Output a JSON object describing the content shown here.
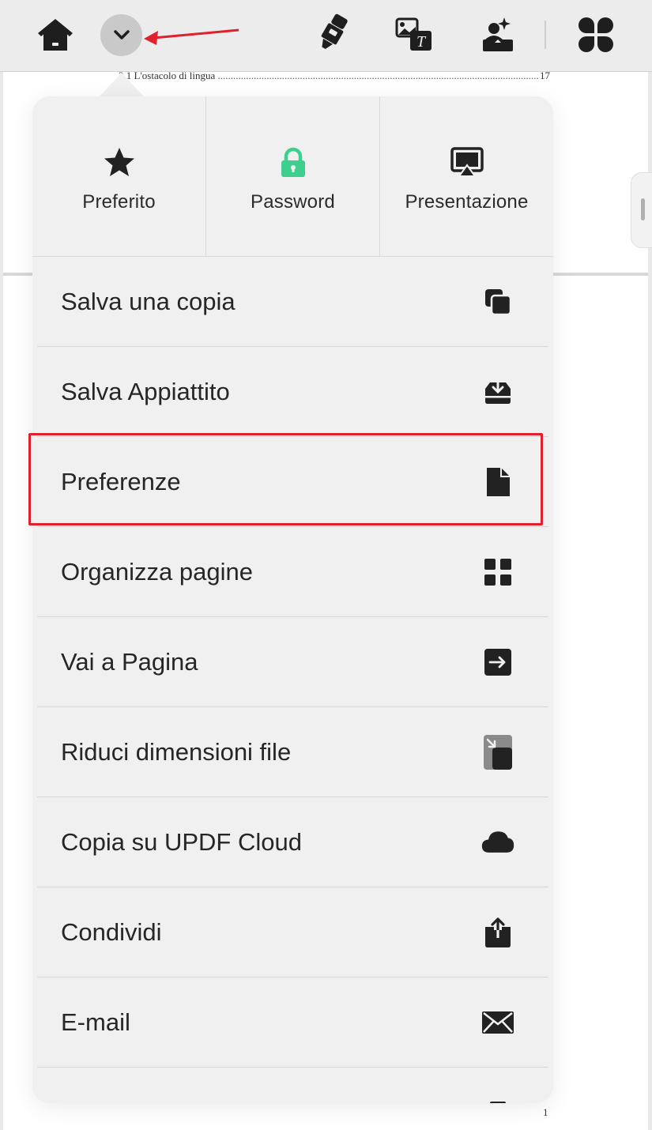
{
  "document": {
    "toc_line": "2.1 L'ostacolo di lingua",
    "toc_line_page": "17",
    "footer_page": "1"
  },
  "toolbar": {
    "icons": [
      "home-icon",
      "chevron-down-icon",
      "highlighter-icon",
      "ocr-icon",
      "ai-image-icon",
      "apps-icon"
    ]
  },
  "quick_actions": [
    {
      "label": "Preferito",
      "icon": "star-icon"
    },
    {
      "label": "Password",
      "icon": "lock-icon",
      "color": "#3ecf8e"
    },
    {
      "label": "Presentazione",
      "icon": "presentation-icon"
    }
  ],
  "menu": {
    "items": [
      {
        "label": "Salva una copia",
        "icon": "copy-icon"
      },
      {
        "label": "Salva Appiattito",
        "icon": "download-tray-icon"
      },
      {
        "label": "Preferenze",
        "icon": "document-icon",
        "highlighted": true
      },
      {
        "label": "Organizza pagine",
        "icon": "grid-icon"
      },
      {
        "label": "Vai a Pagina",
        "icon": "go-to-page-icon"
      },
      {
        "label": "Riduci dimensioni file",
        "icon": "compress-icon"
      },
      {
        "label": "Copia su UPDF Cloud",
        "icon": "cloud-icon"
      },
      {
        "label": "Condividi",
        "icon": "share-icon"
      },
      {
        "label": "E-mail",
        "icon": "mail-icon"
      }
    ]
  },
  "annotations": {
    "highlight_color": "#e0202c",
    "arrow_color": "#e0202c"
  }
}
